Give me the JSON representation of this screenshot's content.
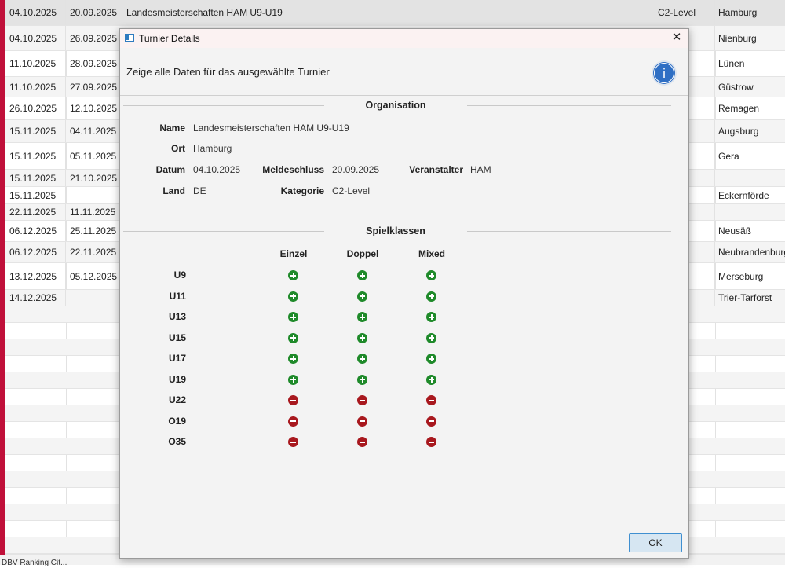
{
  "table": {
    "rows": [
      {
        "date": "04.10.2025",
        "deadline": "20.09.2025",
        "name": "Landesmeisterschaften HAM U9-U19",
        "category": "C2-Level",
        "place": "Hamburg"
      },
      {
        "date": "04.10.2025",
        "deadline": "26.09.2025",
        "name": "",
        "category": "l",
        "place": "Nienburg"
      },
      {
        "date": "11.10.2025",
        "deadline": "28.09.2025",
        "name": "",
        "category": "l",
        "place": "Lünen"
      },
      {
        "date": "11.10.2025",
        "deadline": "27.09.2025",
        "name": "",
        "category": "l",
        "place": "Güstrow"
      },
      {
        "date": "26.10.2025",
        "deadline": "12.10.2025",
        "name": "",
        "category": "l",
        "place": "Remagen"
      },
      {
        "date": "15.11.2025",
        "deadline": "04.11.2025",
        "name": "",
        "category": "l",
        "place": "Augsburg"
      },
      {
        "date": "15.11.2025",
        "deadline": "05.11.2025",
        "name": "",
        "category": "l",
        "place": "Gera"
      },
      {
        "date": "15.11.2025",
        "deadline": "21.10.2025",
        "name": "",
        "category": "l",
        "place": ""
      },
      {
        "date": "15.11.2025",
        "deadline": "",
        "name": "",
        "category": "l",
        "place": "Eckernförde"
      },
      {
        "date": "22.11.2025",
        "deadline": "11.11.2025",
        "name": "",
        "category": "l",
        "place": ""
      },
      {
        "date": "06.12.2025",
        "deadline": "25.11.2025",
        "name": "",
        "category": "l",
        "place": "Neusäß"
      },
      {
        "date": "06.12.2025",
        "deadline": "22.11.2025",
        "name": "",
        "category": "l",
        "place": "Neubrandenburg"
      },
      {
        "date": "13.12.2025",
        "deadline": "05.12.2025",
        "name": "",
        "category": "l",
        "place": "Merseburg"
      },
      {
        "date": "14.12.2025",
        "deadline": "",
        "name": "",
        "category": "l",
        "place": "Trier-Tarforst"
      }
    ]
  },
  "footer": {
    "text": "DBV Ranking Cit..."
  },
  "dialog": {
    "title": "Turnier Details",
    "close_label": "✕",
    "header_text": "Zeige alle Daten für das ausgewählte Turnier",
    "info_glyph": "i",
    "org_section_title": "Organisation",
    "labels": {
      "name": "Name",
      "ort": "Ort",
      "datum": "Datum",
      "meldeschluss": "Meldeschluss",
      "veranstalter": "Veranstalter",
      "land": "Land",
      "kategorie": "Kategorie"
    },
    "values": {
      "name": "Landesmeisterschaften HAM U9-U19",
      "ort": "Hamburg",
      "datum": "04.10.2025",
      "meldeschluss": "20.09.2025",
      "veranstalter": "HAM",
      "land": "DE",
      "kategorie": "C2-Level"
    },
    "spielklassen_title": "Spielklassen",
    "columns": [
      "Einzel",
      "Doppel",
      "Mixed"
    ],
    "classes": [
      {
        "label": "U9",
        "status": [
          "yes",
          "yes",
          "yes"
        ]
      },
      {
        "label": "U11",
        "status": [
          "yes",
          "yes",
          "yes"
        ]
      },
      {
        "label": "U13",
        "status": [
          "yes",
          "yes",
          "yes"
        ]
      },
      {
        "label": "U15",
        "status": [
          "yes",
          "yes",
          "yes"
        ]
      },
      {
        "label": "U17",
        "status": [
          "yes",
          "yes",
          "yes"
        ]
      },
      {
        "label": "U19",
        "status": [
          "yes",
          "yes",
          "yes"
        ]
      },
      {
        "label": "U22",
        "status": [
          "no",
          "no",
          "no"
        ]
      },
      {
        "label": "O19",
        "status": [
          "no",
          "no",
          "no"
        ]
      },
      {
        "label": "O35",
        "status": [
          "no",
          "no",
          "no"
        ]
      }
    ],
    "ok_label": "OK"
  },
  "colors": {
    "yes": "#1f8a2a",
    "no": "#a8181e",
    "accent_stripe": "#c0103a",
    "info_blue": "#2f6fc4"
  }
}
